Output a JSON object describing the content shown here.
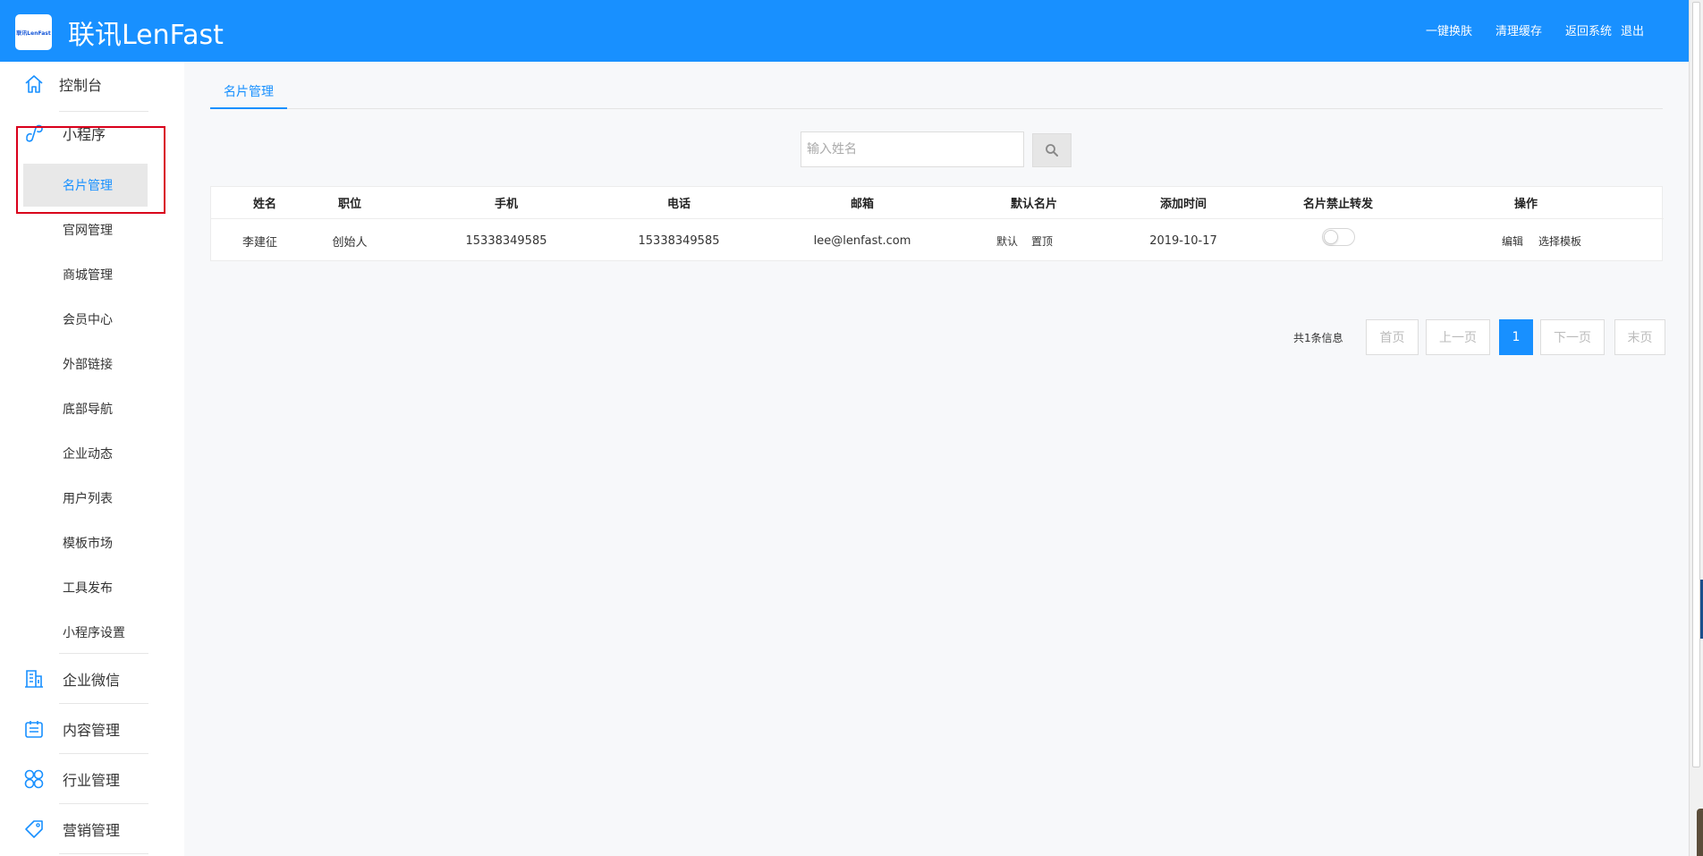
{
  "header": {
    "logo_text": "联讯LenFast",
    "brand": "联讯LenFast",
    "links": [
      "一键换肤",
      "清理缓存",
      "返回系统",
      "退出"
    ],
    "bg_color": "#1890ff"
  },
  "sidebar": {
    "groups": [
      {
        "label": "控制台",
        "icon": "home-icon"
      },
      {
        "label": "小程序",
        "icon": "mini-program-icon"
      },
      {
        "label": "企业微信",
        "icon": "building-icon"
      },
      {
        "label": "内容管理",
        "icon": "calendar-icon"
      },
      {
        "label": "行业管理",
        "icon": "clover-icon"
      },
      {
        "label": "营销管理",
        "icon": "tag-icon"
      }
    ],
    "active_sub": "名片管理",
    "subs": [
      "官网管理",
      "商城管理",
      "会员中心",
      "外部链接",
      "底部导航",
      "企业动态",
      "用户列表",
      "模板市场",
      "工具发布",
      "小程序设置"
    ]
  },
  "tabs": [
    {
      "label": "名片管理",
      "active": true
    }
  ],
  "search": {
    "placeholder": "输入姓名",
    "value": ""
  },
  "table": {
    "headers": [
      "姓名",
      "职位",
      "手机",
      "电话",
      "邮箱",
      "默认名片",
      "添加时间",
      "名片禁止转发",
      "操作"
    ],
    "rows": [
      {
        "name": "李建征",
        "position": "创始人",
        "mobile": "15338349585",
        "phone": "15338349585",
        "email": "lee@lenfast.com",
        "default_label": "默认",
        "top_label": "置顶",
        "added": "2019-10-17",
        "forward_disabled": false,
        "edit_label": "编辑",
        "template_label": "选择模板"
      }
    ]
  },
  "pagination": {
    "info": "共1条信息",
    "first": "首页",
    "prev": "上一页",
    "current": "1",
    "next": "下一页",
    "last": "末页"
  }
}
